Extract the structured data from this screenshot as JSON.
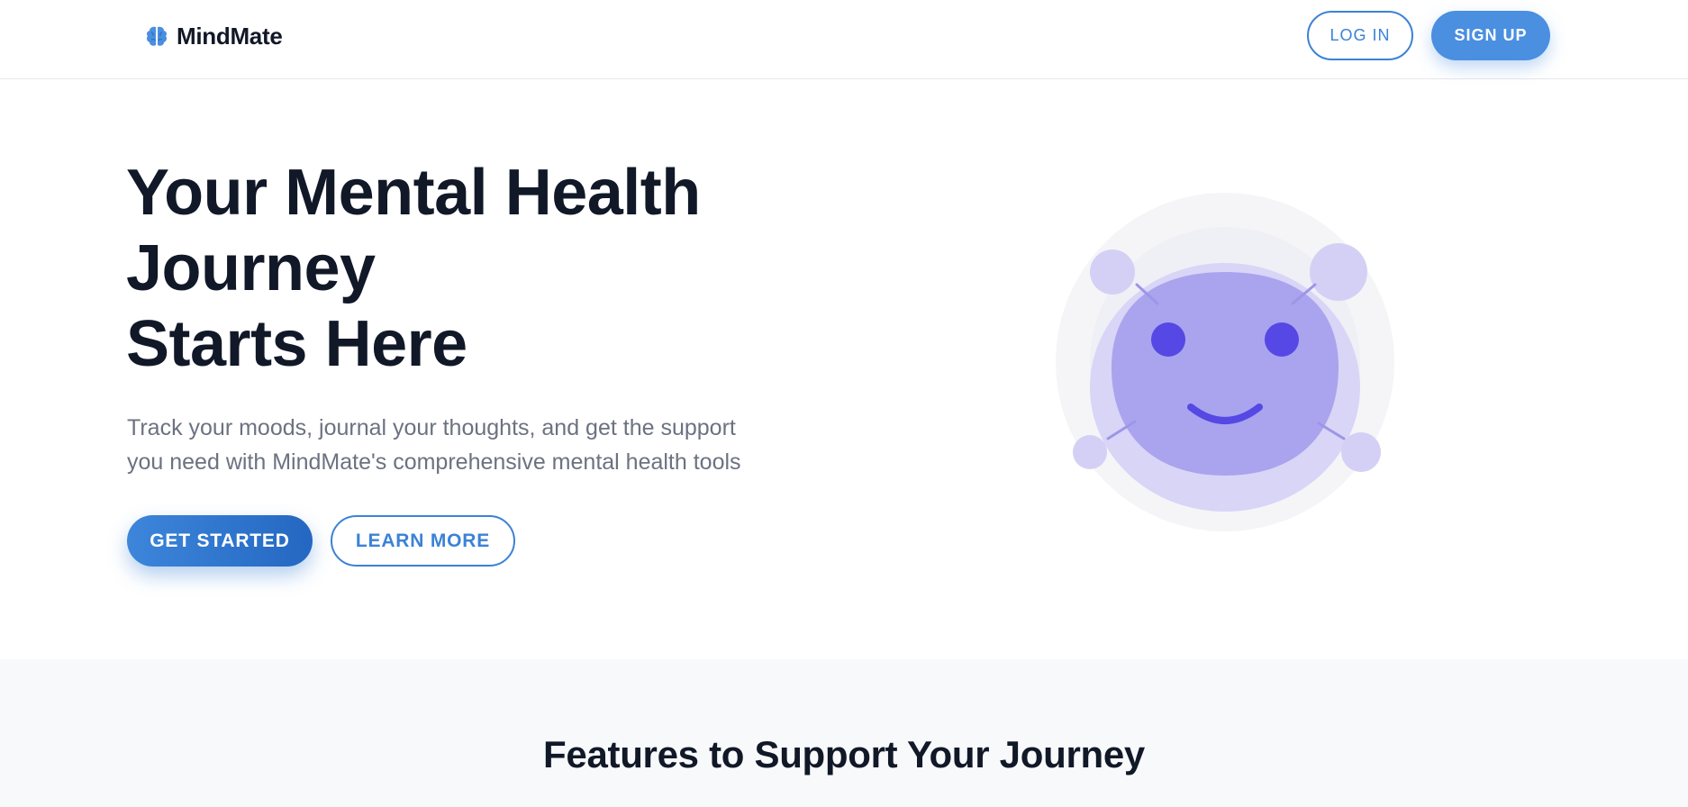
{
  "header": {
    "brand_name": "MindMate",
    "brand_icon": "brain-icon",
    "login_label": "LOG IN",
    "signup_label": "SIGN UP"
  },
  "hero": {
    "title_lines": [
      "Your Mental Health",
      "Journey",
      "Starts Here"
    ],
    "subtitle_lines": [
      "Track your moods, journal your thoughts, and get the support",
      "you need with MindMate's comprehensive mental health tools"
    ],
    "primary_button": "GET STARTED",
    "secondary_button": "LEARN MORE",
    "illustration": "smiling-face-illustration"
  },
  "features": {
    "title": "Features to Support Your Journey"
  },
  "colors": {
    "accent": "#3b82d6",
    "heading": "#111827",
    "body_text": "#6b7280",
    "illustration_face": "#aaa4ee",
    "illustration_features": "#5548e4"
  }
}
